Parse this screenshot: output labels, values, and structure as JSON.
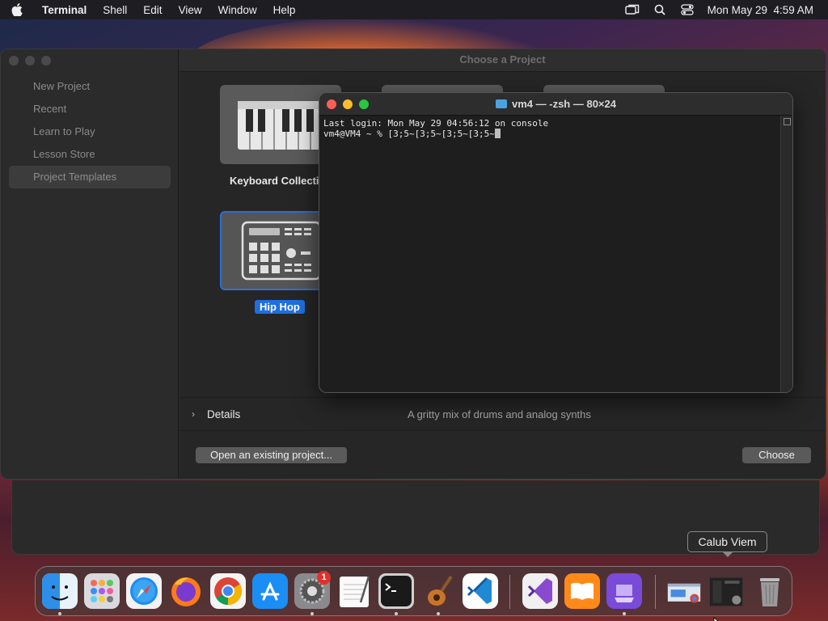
{
  "menubar": {
    "app_name": "Terminal",
    "menus": [
      "Shell",
      "Edit",
      "View",
      "Window",
      "Help"
    ],
    "clock": "Mon May 29  4:59 AM"
  },
  "garageband": {
    "title": "Choose a Project",
    "sidebar": [
      "New Project",
      "Recent",
      "Learn to Play",
      "Lesson Store",
      "Project Templates"
    ],
    "selected_sidebar": "Project Templates",
    "tiles": {
      "keyboard": "Keyboard Collecti",
      "hiphop": "Hip Hop"
    },
    "details_label": "Details",
    "details_desc": "A gritty mix of drums and analog synths",
    "open_button": "Open an existing project...",
    "choose_button": "Choose"
  },
  "terminal": {
    "title": "vm4 — -zsh — 80×24",
    "lines": [
      "Last login: Mon May 29 04:56:12 on console",
      "vm4@VM4 ~ % [3;5~[3;5~[3;5~[3;5~"
    ]
  },
  "dock": {
    "tooltip": "Calub Viem",
    "settings_badge": "1",
    "apps": [
      "Finder",
      "Launchpad",
      "Safari",
      "Firefox",
      "Chrome",
      "App Store",
      "System Settings",
      "TextEdit",
      "Terminal",
      "GarageBand",
      "Visual Studio Code",
      "Visual Studio",
      "Books",
      "Apple Configurator",
      "Window Preview",
      "Window Preview 2",
      "Trash"
    ]
  }
}
